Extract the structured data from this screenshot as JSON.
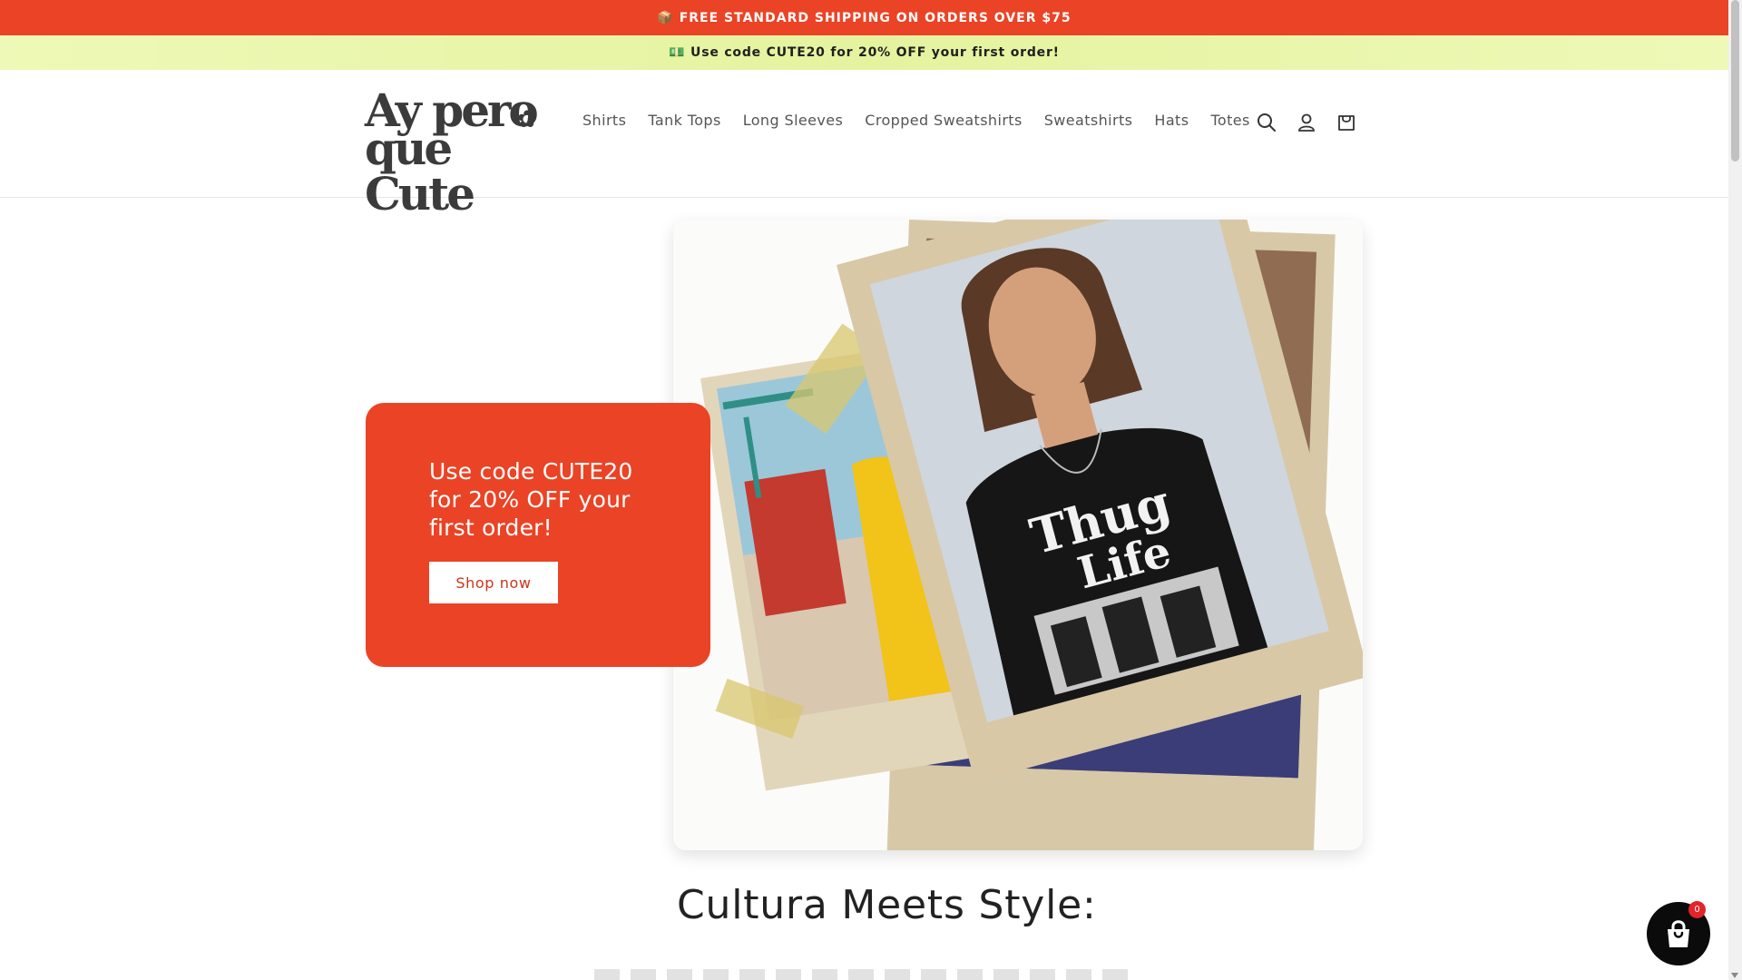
{
  "announcement": {
    "shipping": "📦 FREE STANDARD SHIPPING ON ORDERS OVER $75",
    "promo": "💵 Use code CUTE20 for 20% OFF your first order!"
  },
  "header": {
    "logo_line1": "Ay pero",
    "logo_line2": "que Cute",
    "nav": [
      "Shirts",
      "Tank Tops",
      "Long Sleeves",
      "Cropped Sweatshirts",
      "Sweatshirts",
      "Hats",
      "Totes"
    ],
    "icons": [
      "search-icon",
      "account-icon",
      "cart-icon"
    ]
  },
  "hero": {
    "promo_text": "Use code CUTE20 for 20% OFF your first order!",
    "button_label": "Shop now",
    "image_text": "Thug Life"
  },
  "section": {
    "heading": "Cultura Meets Style:"
  },
  "cart_widget": {
    "count": "0"
  },
  "colors": {
    "brand_red": "#eb4325",
    "promo_bar": "#e9f5a8",
    "dark": "#0b0b0b"
  }
}
